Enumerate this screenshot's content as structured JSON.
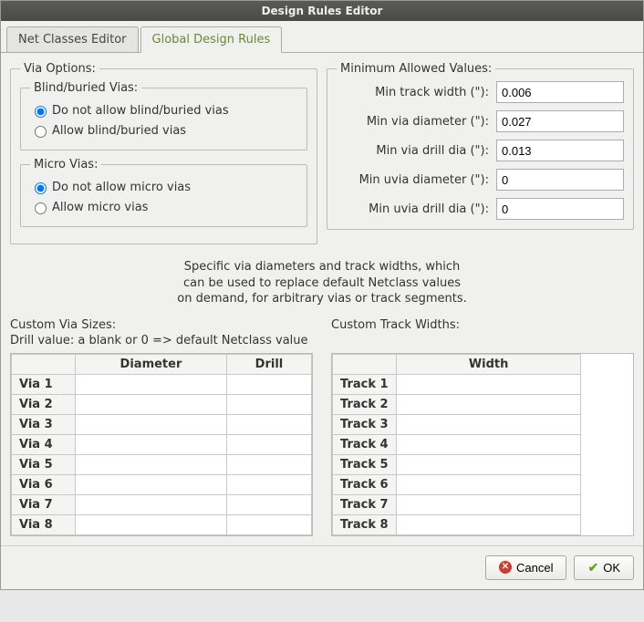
{
  "window": {
    "title": "Design Rules Editor"
  },
  "tabs": {
    "net_classes": "Net Classes Editor",
    "global": "Global Design Rules"
  },
  "via_options": {
    "legend": "Via Options:",
    "blind": {
      "legend": "Blind/buried Vias:",
      "no": "Do not allow blind/buried vias",
      "yes": "Allow blind/buried vias"
    },
    "micro": {
      "legend": "Micro Vias:",
      "no": "Do not allow micro vias",
      "yes": "Allow micro vias"
    }
  },
  "min_values": {
    "legend": "Minimum Allowed Values:",
    "track_label": "Min track width (\"):",
    "track_val": "0.006",
    "via_dia_label": "Min via diameter (\"):",
    "via_dia_val": "0.027",
    "via_drill_label": "Min via drill dia (\"):",
    "via_drill_val": "0.013",
    "uvia_dia_label": "Min uvia diameter (\"):",
    "uvia_dia_val": "0",
    "uvia_drill_label": "Min uvia drill dia (\"):",
    "uvia_drill_val": "0"
  },
  "help": {
    "l1": "Specific via diameters and track widths, which",
    "l2": "can be used to replace default Netclass values",
    "l3": "on demand, for arbitrary vias or track segments."
  },
  "custom_via": {
    "title": "Custom Via Sizes:",
    "help": "Drill value: a blank or 0 => default Netclass value",
    "col_dia": "Diameter",
    "col_drill": "Drill",
    "rows": [
      "Via 1",
      "Via 2",
      "Via 3",
      "Via 4",
      "Via 5",
      "Via 6",
      "Via 7",
      "Via 8"
    ]
  },
  "custom_track": {
    "title": "Custom Track Widths:",
    "col_width": "Width",
    "rows": [
      "Track 1",
      "Track 2",
      "Track 3",
      "Track 4",
      "Track 5",
      "Track 6",
      "Track 7",
      "Track 8"
    ]
  },
  "buttons": {
    "cancel": "Cancel",
    "ok": "OK"
  }
}
